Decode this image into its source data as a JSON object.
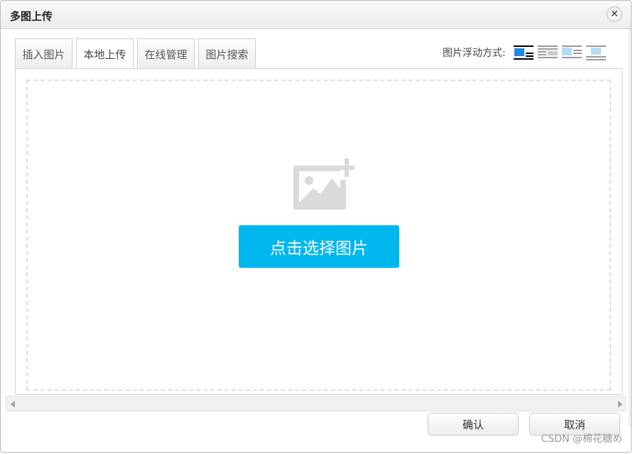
{
  "dialog": {
    "title": "多图上传",
    "close_symbol": "✕"
  },
  "tabs": [
    {
      "label": "插入图片",
      "active": false
    },
    {
      "label": "本地上传",
      "active": true
    },
    {
      "label": "在线管理",
      "active": false
    },
    {
      "label": "图片搜索",
      "active": false
    }
  ],
  "float": {
    "label": "图片浮动方式:",
    "icons": [
      "float-none-icon",
      "float-left-icon",
      "float-right-icon",
      "float-center-icon"
    ],
    "selected_index": 0
  },
  "upload": {
    "button_label": "点击选择图片",
    "icon": "image-plus-icon"
  },
  "footer": {
    "confirm_label": "确认",
    "cancel_label": "取消"
  },
  "watermark": "CSDN @棉花糖め",
  "colors": {
    "accent": "#00b7ee",
    "selected_icon": "#1e88e5",
    "icon_gray": "#dadada"
  }
}
